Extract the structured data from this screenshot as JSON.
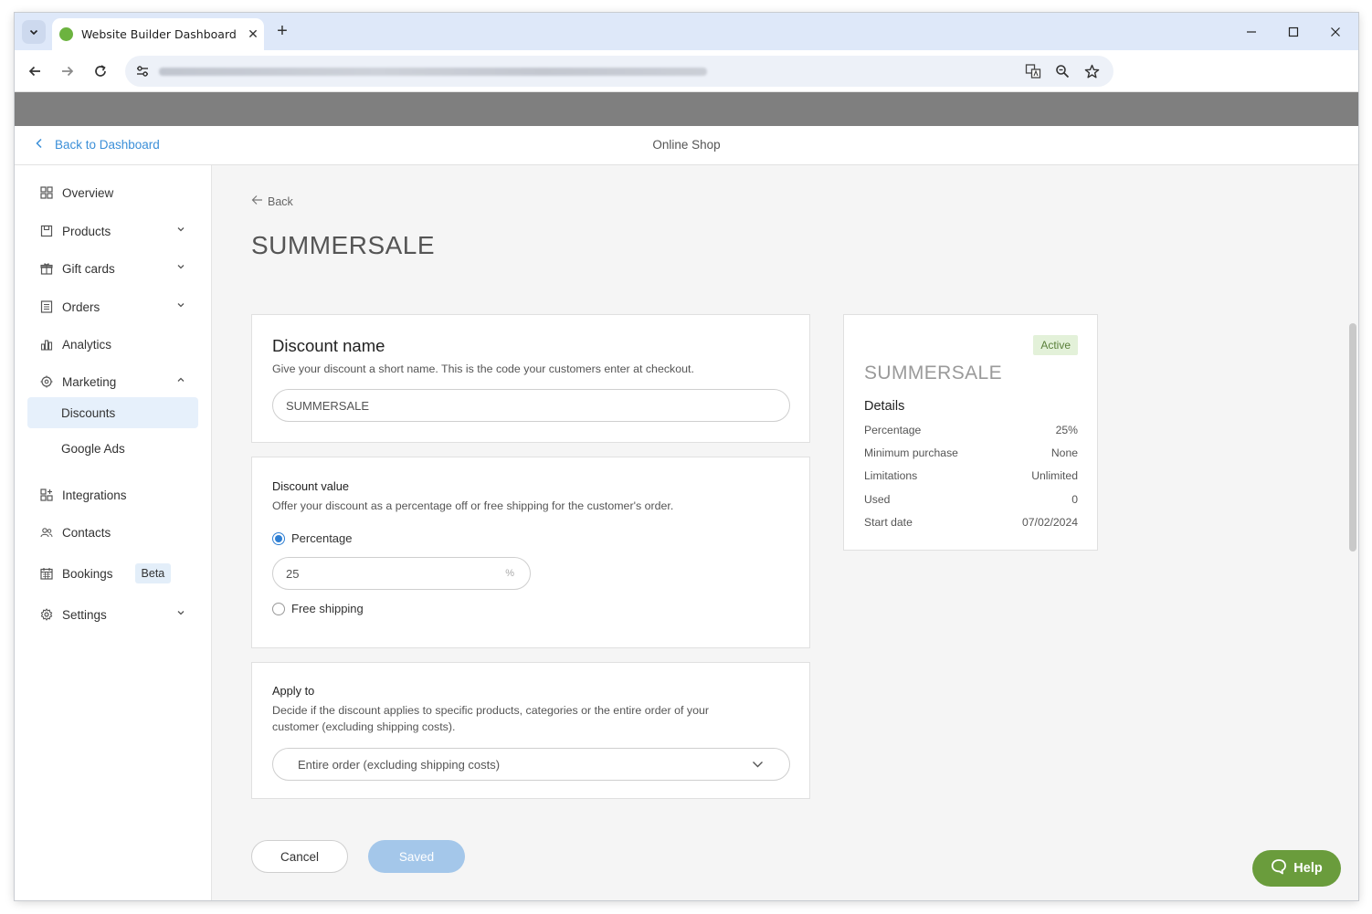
{
  "browser": {
    "tab_title": "Website Builder Dashboard",
    "tab_close": "✕",
    "new_tab": "+",
    "minimize": "—",
    "maximize": "☐",
    "close": "✕"
  },
  "header": {
    "back_to_dashboard": "Back to Dashboard",
    "shop_name": "Online Shop"
  },
  "sidebar": {
    "items": [
      {
        "label": "Overview",
        "icon": "grid-icon"
      },
      {
        "label": "Products",
        "icon": "box-icon"
      },
      {
        "label": "Gift cards",
        "icon": "gift-icon"
      },
      {
        "label": "Orders",
        "icon": "list-icon"
      },
      {
        "label": "Analytics",
        "icon": "chart-icon"
      },
      {
        "label": "Marketing",
        "icon": "target-icon"
      },
      {
        "label": "Discounts",
        "icon": ""
      },
      {
        "label": "Google Ads",
        "icon": ""
      },
      {
        "label": "Integrations",
        "icon": "plug-icon"
      },
      {
        "label": "Contacts",
        "icon": "people-icon"
      },
      {
        "label": "Bookings",
        "icon": "calendar-icon",
        "badge": "Beta"
      },
      {
        "label": "Settings",
        "icon": "gear-icon"
      }
    ]
  },
  "main": {
    "back": "Back",
    "title": "SUMMERSALE",
    "discount_name": {
      "heading": "Discount name",
      "description": "Give your discount a short name. This is the code your customers enter at checkout.",
      "value": "SUMMERSALE"
    },
    "discount_value": {
      "heading": "Discount value",
      "description": "Offer your discount as a percentage off or free shipping for the customer's order.",
      "option_percentage": "Percentage",
      "percentage_value": "25",
      "percentage_unit": "%",
      "option_free_shipping": "Free shipping",
      "selected": "Percentage"
    },
    "apply_to": {
      "heading": "Apply to",
      "description_line1": "Decide if the discount applies to specific products, categories or the entire order of your",
      "description_line2": "customer (excluding shipping costs).",
      "selected": "Entire order (excluding shipping costs)"
    },
    "cancel": "Cancel",
    "saved": "Saved"
  },
  "summary": {
    "status": "Active",
    "title": "SUMMERSALE",
    "details_heading": "Details",
    "rows": [
      {
        "label": "Percentage",
        "value": "25%"
      },
      {
        "label": "Minimum purchase",
        "value": "None"
      },
      {
        "label": "Limitations",
        "value": "Unlimited"
      },
      {
        "label": "Used",
        "value": "0"
      },
      {
        "label": "Start date",
        "value": "07/02/2024"
      }
    ]
  },
  "help": {
    "label": "Help"
  },
  "colors": {
    "accent": "#3b8fd8",
    "active_badge_bg": "#e3f1d9",
    "help_green": "#6a9c3c",
    "saved_button": "#a4c7ea"
  }
}
